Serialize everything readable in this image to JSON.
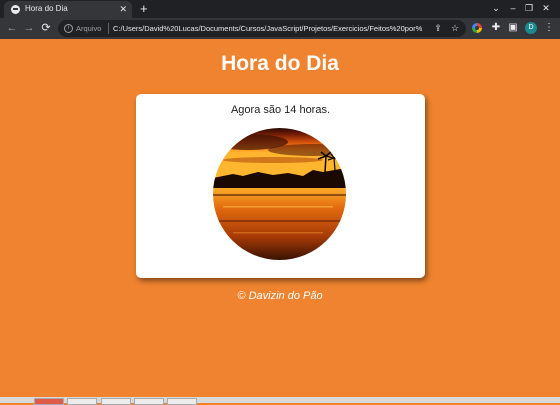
{
  "browser": {
    "tab_title": "Hora do Dia",
    "tab_close": "✕",
    "new_tab": "+",
    "omnibox_label": "Arquivo",
    "url": "C:/Users/David%20Lucas/Documents/Cursos/JavaScript/Projetos/Exercicios/Feitos%20por%...",
    "profile_initial": "D",
    "back": "←",
    "forward": "→",
    "reload": "⟳"
  },
  "page": {
    "title": "Hora do Dia",
    "message": "Agora são 14 horas.",
    "footer": "© Davizin do Pão"
  },
  "colors": {
    "background": "#f0832f",
    "card": "#ffffff",
    "chrome_dark": "#202124"
  },
  "icons": [
    "info-icon",
    "share-icon",
    "star-icon",
    "extension-color-icon",
    "puzzle-icon",
    "sidebar-icon",
    "profile-avatar",
    "menu-icon"
  ]
}
